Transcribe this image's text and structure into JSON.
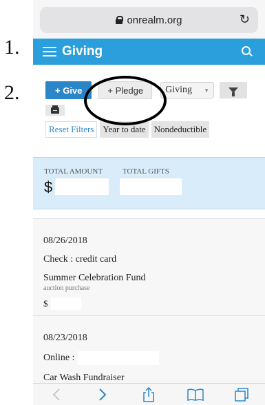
{
  "annotations": {
    "first": "1.",
    "second": "2."
  },
  "browser": {
    "url": "onrealm.org"
  },
  "header": {
    "title": "Giving"
  },
  "toolbar": {
    "give_label": "+ Give",
    "pledge_label": "+ Pledge",
    "type_select": "Giving"
  },
  "filters": [
    "Reset Filters",
    "Year to date",
    "Nondeductible"
  ],
  "totals": {
    "amount_label": "TOTAL AMOUNT",
    "gifts_label": "TOTAL GIFTS",
    "currency": "$"
  },
  "gifts": [
    {
      "date": "08/26/2018",
      "method": "Check : credit card",
      "fund": "Summer Celebration Fund",
      "note": "auction purchase",
      "currency": "$"
    },
    {
      "date": "08/23/2018",
      "method": "Online :",
      "fund": "Car Wash Fundraiser",
      "currency": "$"
    }
  ],
  "colors": {
    "brand": "#2b9fdc",
    "button": "#2b86c9",
    "totals_bg": "#d9ecf9"
  }
}
